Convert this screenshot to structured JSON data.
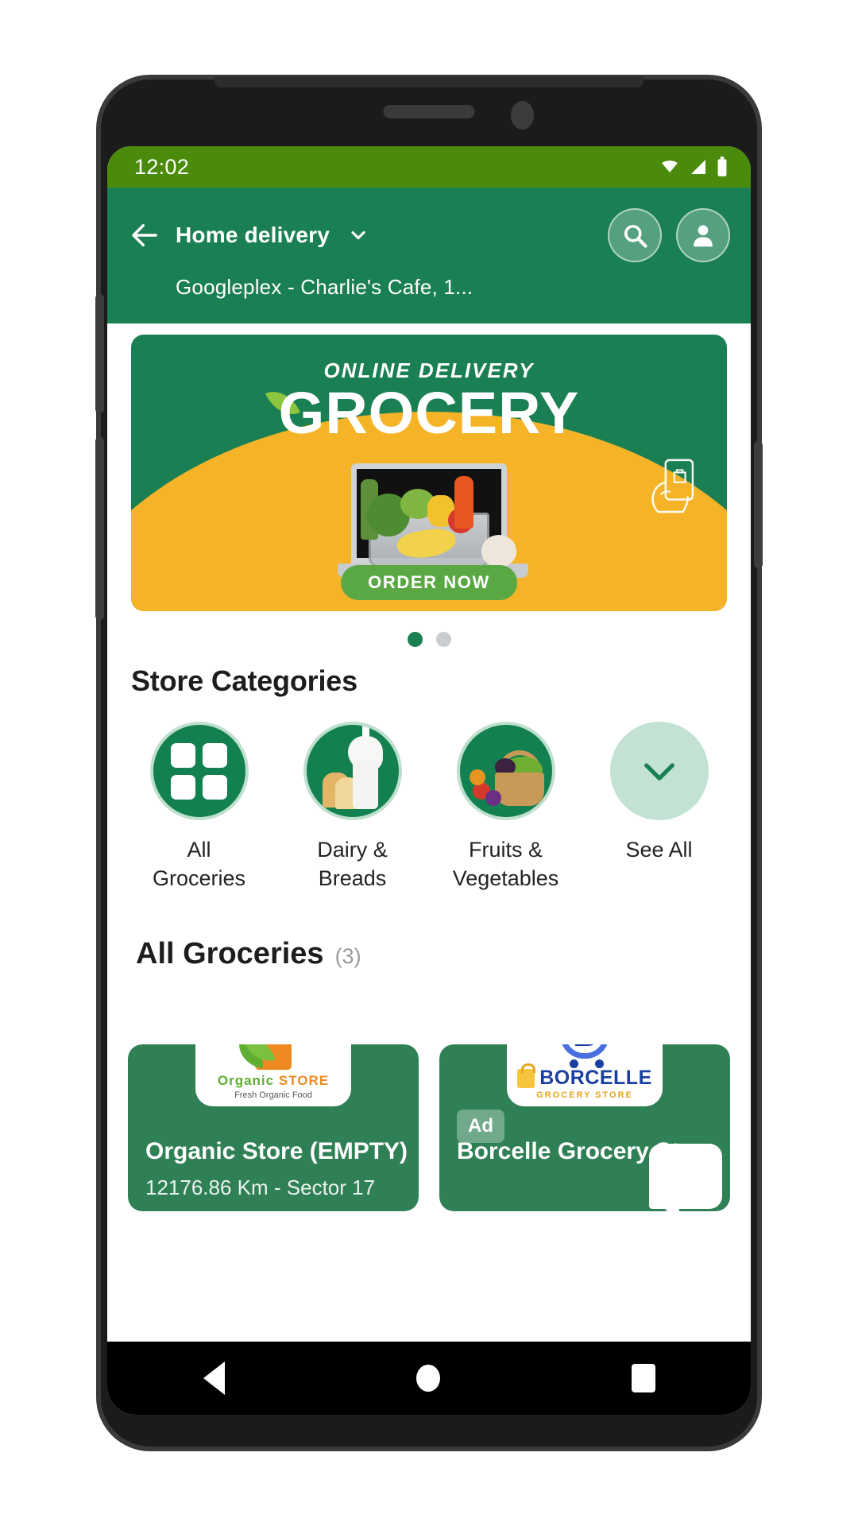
{
  "status_bar": {
    "time": "12:02",
    "icons": [
      "wifi-icon",
      "cellular-signal-icon",
      "battery-icon"
    ]
  },
  "app_bar": {
    "back_icon": "back-arrow-icon",
    "delivery_mode": "Home delivery",
    "chevron_icon": "chevron-down-icon",
    "address": "Googleplex - Charlie's Cafe, 1...",
    "search_icon": "search-icon",
    "profile_icon": "profile-avatar-icon"
  },
  "banner": {
    "subtitle": "ONLINE DELIVERY",
    "title": "GROCERY",
    "cta": "ORDER NOW",
    "side_icon": "phone-in-hand-icon",
    "green": "#1a7f53",
    "yellow": "#f5b327"
  },
  "carousel": {
    "dots": 2,
    "active_index": 0,
    "active_color": "#1a7f53",
    "inactive_color": "#c9cdcf"
  },
  "store_categories": {
    "title": "Store Categories",
    "items": [
      {
        "label": "All\nGroceries",
        "label_line1": "All",
        "label_line2": "Groceries",
        "icon": "grid-four-squares-icon",
        "style": "solid"
      },
      {
        "label": "Dairy &\nBreads",
        "label_line1": "Dairy &",
        "label_line2": "Breads",
        "icon": "milk-bread-photo",
        "style": "photo"
      },
      {
        "label": "Fruits &\nVegetables",
        "label_line1": "Fruits &",
        "label_line2": "Vegetables",
        "icon": "fruit-basket-photo",
        "style": "photo"
      },
      {
        "label": "See All",
        "label_line1": "See All",
        "label_line2": "",
        "icon": "chevron-down-icon",
        "style": "mint"
      }
    ]
  },
  "all_groceries": {
    "title": "All Groceries",
    "count": "(3)",
    "stores": [
      {
        "name": "Organic Store (EMPTY)",
        "meta": "12176.86 Km  -  Sector 17",
        "logo_name_part1": "Organic",
        "logo_name_part2": "STORE",
        "logo_tagline": "Fresh Organic Food",
        "badge": ""
      },
      {
        "name": "Borcelle Grocery Store",
        "meta": "",
        "logo_name_part1": "BORCELLE",
        "logo_name_part2": "GROCERY STORE",
        "logo_tagline": "",
        "badge": "Ad"
      }
    ]
  },
  "chat": {
    "icon": "chat-bubble-icon"
  },
  "nav_bar": {
    "back": "nav-back-icon",
    "home": "nav-home-icon",
    "recents": "nav-recents-icon"
  },
  "colors": {
    "status_bar": "#4b8b0b",
    "app_bar": "#1a7f53",
    "accent_green": "#12814f",
    "card_green": "#2f8055",
    "mint": "#c3e2d3"
  }
}
